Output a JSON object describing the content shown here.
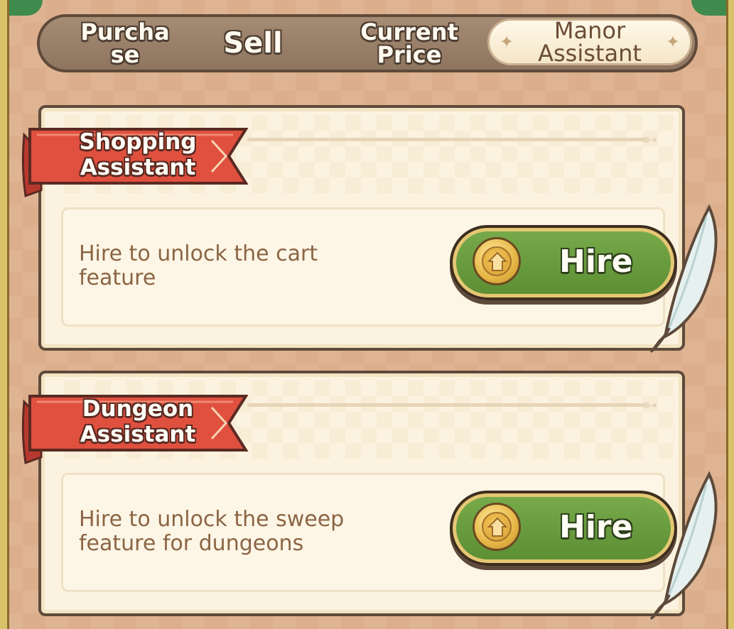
{
  "tabs": [
    {
      "id": "purchase",
      "label_line1": "Purcha",
      "label_line2": "se",
      "active": false
    },
    {
      "id": "sell",
      "label": "Sell",
      "active": false
    },
    {
      "id": "current_price",
      "label_line1": "Current",
      "label_line2": "Price",
      "active": false
    },
    {
      "id": "manor_assistant",
      "label_line1": "Manor",
      "label_line2": "Assistant",
      "active": true
    }
  ],
  "assistants": [
    {
      "title_line1": "Shopping",
      "title_line2": "Assistant",
      "description_line1": "Hire to unlock the cart",
      "description_line2": "feature",
      "button_label": "Hire"
    },
    {
      "title_line1": "Dungeon",
      "title_line2": "Assistant",
      "description_line1": "Hire to unlock the sweep",
      "description_line2": "feature for dungeons",
      "button_label": "Hire"
    }
  ],
  "icons": {
    "tab_sparkle": "sparkle-icon",
    "coin": "gold-coin-icon",
    "quill": "quill-feather-icon",
    "ribbon": "ribbon-banner"
  },
  "colors": {
    "background": "#dcae8b",
    "card": "#fbf3df",
    "hire_button": "#6a9c3e",
    "ribbon": "#e0503f",
    "text_brown": "#8b6545"
  }
}
